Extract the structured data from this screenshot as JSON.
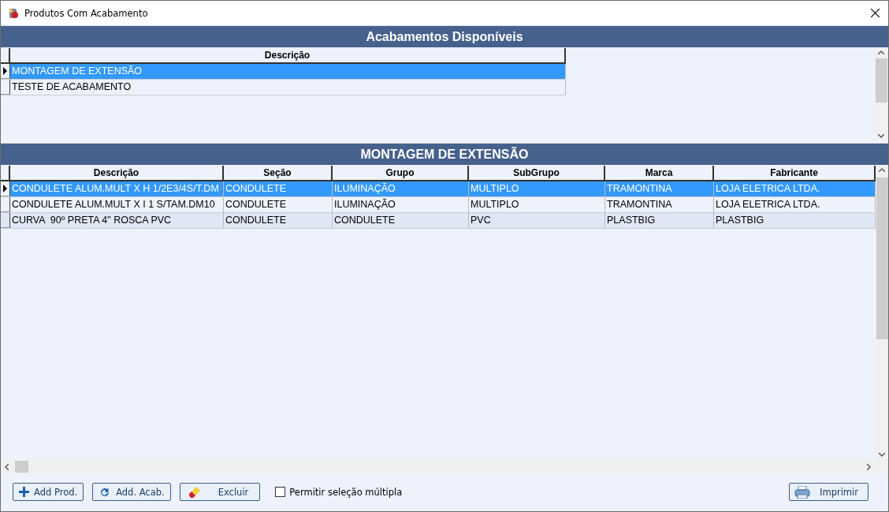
{
  "window": {
    "title": "Produtos Com Acabamento"
  },
  "finishes_panel": {
    "title": "Acabamentos Disponíveis",
    "columns": [
      "Descrição"
    ],
    "rows": [
      {
        "cells": [
          "MONTAGEM DE EXTENSÃO"
        ],
        "selected": true
      },
      {
        "cells": [
          "TESTE DE ACABAMENTO"
        ],
        "selected": false
      }
    ]
  },
  "products_panel": {
    "title": "MONTAGEM DE EXTENSÃO",
    "columns": [
      "Descrição",
      "Seção",
      "Grupo",
      "SubGrupo",
      "Marca",
      "Fabricante"
    ],
    "rows": [
      {
        "cells": [
          "CONDULETE ALUM.MULT X H 1/2E3/4S/T.DM",
          "CONDULETE",
          "ILUMINAÇÃO",
          "MULTIPLO",
          "TRAMONTINA",
          "LOJA ELETRICA LTDA."
        ],
        "selected": true
      },
      {
        "cells": [
          "CONDULETE ALUM.MULT X I 1 S/TAM.DM10",
          "CONDULETE",
          "ILUMINAÇÃO",
          "MULTIPLO",
          "TRAMONTINA",
          "LOJA ELETRICA LTDA."
        ],
        "selected": false
      },
      {
        "cells": [
          "CURVA  90º PRETA 4\" ROSCA PVC",
          "CONDULETE",
          "CONDULETE",
          "PVC",
          "PLASTBIG",
          "PLASTBIG"
        ],
        "selected": false
      }
    ]
  },
  "buttons": [
    {
      "label": "Add Prod.",
      "kind": "plus"
    },
    {
      "label": "Add. Acab.",
      "kind": "refresh"
    },
    {
      "label": "Excluir",
      "kind": "eraser"
    }
  ],
  "multi_select": {
    "label": "Permitir seleção múltipla",
    "checked": false
  },
  "print_button": {
    "label": "Imprimir",
    "kind": "printer"
  }
}
